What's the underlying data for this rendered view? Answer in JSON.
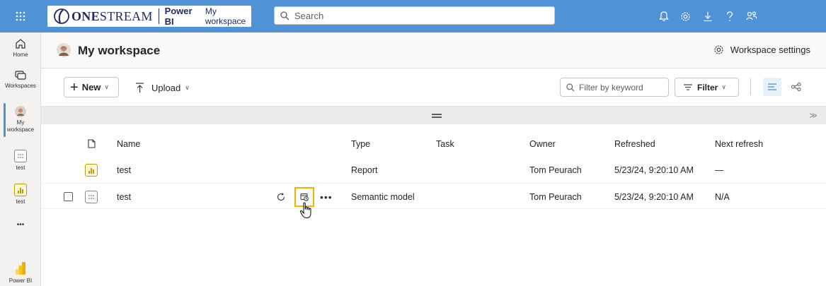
{
  "topbar": {
    "logo_text_bold": "ONE",
    "logo_text_thin": "STREAM",
    "app_name": "Power BI",
    "workspace_crumb": "My workspace",
    "search_placeholder": "Search"
  },
  "rail": {
    "home": "Home",
    "workspaces": "Workspaces",
    "my_workspace_line1": "My",
    "my_workspace_line2": "workspace",
    "test_model": "test",
    "test_report": "test",
    "more": "•••",
    "powerbi": "Power BI"
  },
  "header": {
    "title": "My workspace",
    "settings_label": "Workspace settings"
  },
  "toolbar": {
    "new_label": "New",
    "upload_label": "Upload",
    "filter_placeholder": "Filter by keyword",
    "filter_label": "Filter"
  },
  "table": {
    "columns": {
      "name": "Name",
      "type": "Type",
      "task": "Task",
      "owner": "Owner",
      "refreshed": "Refreshed",
      "next_refresh": "Next refresh"
    },
    "rows": [
      {
        "name": "test",
        "type": "Report",
        "task": "",
        "owner": "Tom Peurach",
        "refreshed": "5/23/24, 9:20:10 AM",
        "next_refresh": "—"
      },
      {
        "name": "test",
        "type": "Semantic model",
        "task": "",
        "owner": "Tom Peurach",
        "refreshed": "5/23/24, 9:20:10 AM",
        "next_refresh": "N/A"
      }
    ],
    "more_actions": "•••"
  },
  "colors": {
    "topbar": "#4f92d6",
    "highlight": "#f0b400",
    "report_icon": "#c19c00"
  }
}
